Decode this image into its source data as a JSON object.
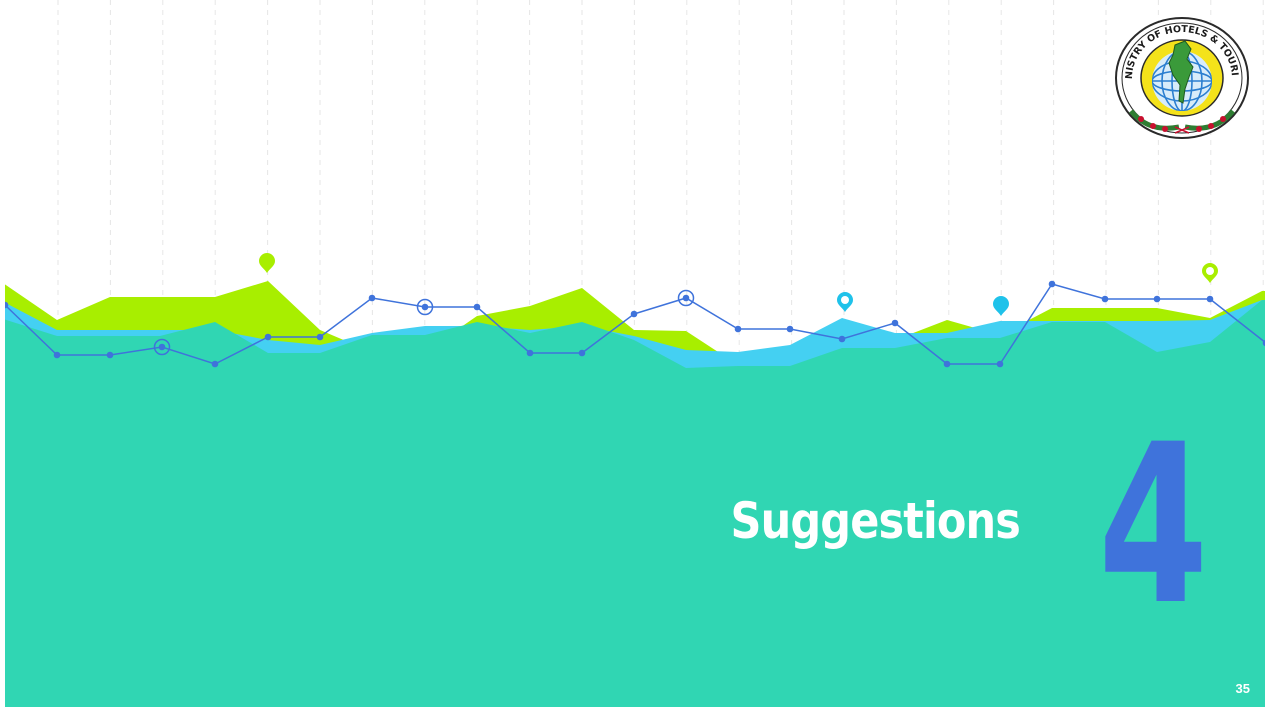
{
  "slide": {
    "title": "Suggestions",
    "section_number": "4",
    "page_number": "35"
  },
  "logo": {
    "name": "ministry-of-hotels-and-tourism-seal",
    "text": "MINISTRY OF HOTELS & TOURISM"
  },
  "colors": {
    "teal": "#30d6b3",
    "lime": "#a8ee00",
    "sky": "#44d0f2",
    "line_blue": "#3f73db",
    "number_blue": "#3f73db",
    "title_white": "#ffffff",
    "grid_gray": "#e2e2e2"
  }
}
